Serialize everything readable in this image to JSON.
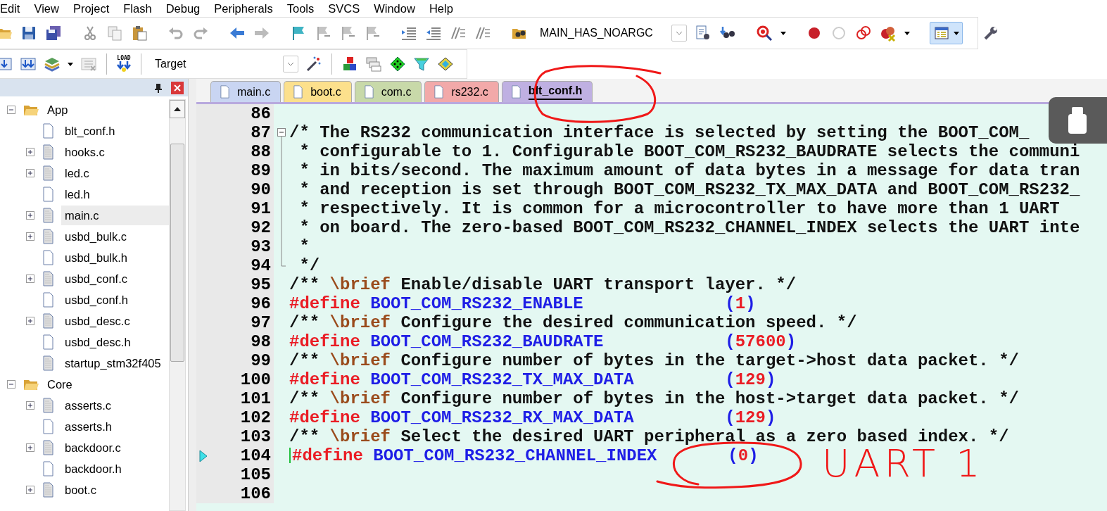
{
  "menu": [
    "Edit",
    "View",
    "Project",
    "Flash",
    "Debug",
    "Peripherals",
    "Tools",
    "SVCS",
    "Window",
    "Help"
  ],
  "toolbar": {
    "define_combo": "MAIN_HAS_NOARGC"
  },
  "build_toolbar": {
    "load_label": "LOAD",
    "target_combo": "Target"
  },
  "project_tree": [
    {
      "label": "App",
      "kind": "folder",
      "expanded": true,
      "selected": false,
      "children": [
        {
          "label": "blt_conf.h",
          "kind": "header",
          "expandable": false,
          "selected": false
        },
        {
          "label": "hooks.c",
          "kind": "source",
          "expandable": true,
          "selected": false
        },
        {
          "label": "led.c",
          "kind": "source",
          "expandable": true,
          "selected": false
        },
        {
          "label": "led.h",
          "kind": "header",
          "expandable": false,
          "selected": false
        },
        {
          "label": "main.c",
          "kind": "source",
          "expandable": true,
          "selected": true
        },
        {
          "label": "usbd_bulk.c",
          "kind": "source",
          "expandable": true,
          "selected": false
        },
        {
          "label": "usbd_bulk.h",
          "kind": "header",
          "expandable": false,
          "selected": false
        },
        {
          "label": "usbd_conf.c",
          "kind": "source",
          "expandable": true,
          "selected": false
        },
        {
          "label": "usbd_conf.h",
          "kind": "header",
          "expandable": false,
          "selected": false
        },
        {
          "label": "usbd_desc.c",
          "kind": "source",
          "expandable": true,
          "selected": false
        },
        {
          "label": "usbd_desc.h",
          "kind": "header",
          "expandable": false,
          "selected": false
        },
        {
          "label": "startup_stm32f405",
          "kind": "source",
          "expandable": false,
          "selected": false
        }
      ]
    },
    {
      "label": "Core",
      "kind": "folder",
      "expanded": true,
      "selected": false,
      "children": [
        {
          "label": "asserts.c",
          "kind": "source",
          "expandable": true,
          "selected": false
        },
        {
          "label": "asserts.h",
          "kind": "header",
          "expandable": false,
          "selected": false
        },
        {
          "label": "backdoor.c",
          "kind": "source",
          "expandable": true,
          "selected": false
        },
        {
          "label": "backdoor.h",
          "kind": "header",
          "expandable": false,
          "selected": false
        },
        {
          "label": "boot.c",
          "kind": "source",
          "expandable": true,
          "selected": false
        }
      ]
    }
  ],
  "tabs": [
    {
      "label": "main.c",
      "color": "#c9d5f2",
      "selected": false
    },
    {
      "label": "boot.c",
      "color": "#fce08c",
      "selected": false
    },
    {
      "label": "com.c",
      "color": "#c8d9a9",
      "selected": false
    },
    {
      "label": "rs232.c",
      "color": "#f2a9a9",
      "selected": false
    },
    {
      "label": "blt_conf.h",
      "color": "#bfb0e2",
      "selected": true
    }
  ],
  "code_lines": [
    {
      "number": "86",
      "kind": "plain"
    },
    {
      "number": "87",
      "kind": "fold_start",
      "segments": [
        {
          "kind": "comment",
          "text": "/* The RS232 communication interface is selected by setting the BOOT_COM_"
        }
      ]
    },
    {
      "number": "88",
      "kind": "fold_inside",
      "segments": [
        {
          "kind": "comment",
          "text": " * configurable to 1. Configurable BOOT_COM_RS232_BAUDRATE selects the communi"
        }
      ]
    },
    {
      "number": "89",
      "kind": "fold_inside",
      "segments": [
        {
          "kind": "comment",
          "text": " * in bits/second. The maximum amount of data bytes in a message for data tran"
        }
      ]
    },
    {
      "number": "90",
      "kind": "fold_inside",
      "segments": [
        {
          "kind": "comment",
          "text": " * and reception is set through BOOT_COM_RS232_TX_MAX_DATA and BOOT_COM_RS232_"
        }
      ]
    },
    {
      "number": "91",
      "kind": "fold_inside",
      "segments": [
        {
          "kind": "comment",
          "text": " * respectively. It is common for a microcontroller to have more than 1 UART"
        }
      ]
    },
    {
      "number": "92",
      "kind": "fold_inside",
      "segments": [
        {
          "kind": "comment",
          "text": " * on board. The zero-based BOOT_COM_RS232_CHANNEL_INDEX selects the UART inte"
        }
      ]
    },
    {
      "number": "93",
      "kind": "fold_inside",
      "segments": [
        {
          "kind": "comment",
          "text": " *"
        }
      ]
    },
    {
      "number": "94",
      "kind": "fold_end",
      "segments": [
        {
          "kind": "comment",
          "text": " */"
        }
      ]
    },
    {
      "number": "95",
      "kind": "plain",
      "segments": [
        {
          "kind": "comment",
          "text": "/** "
        },
        {
          "kind": "doctag",
          "text": "\\brief"
        },
        {
          "kind": "comment",
          "text": " Enable/disable UART transport layer. */"
        }
      ]
    },
    {
      "number": "96",
      "kind": "plain",
      "segments": [
        {
          "kind": "keyword",
          "text": "#define"
        },
        {
          "kind": "macro",
          "text": " BOOT_COM_RS232_ENABLE"
        },
        {
          "kind": "punct",
          "text": "("
        },
        {
          "kind": "number",
          "text": "1"
        },
        {
          "kind": "punct",
          "text": ")"
        }
      ]
    },
    {
      "number": "97",
      "kind": "plain",
      "segments": [
        {
          "kind": "comment",
          "text": "/** "
        },
        {
          "kind": "doctag",
          "text": "\\brief"
        },
        {
          "kind": "comment",
          "text": " Configure the desired communication speed. */"
        }
      ]
    },
    {
      "number": "98",
      "kind": "plain",
      "segments": [
        {
          "kind": "keyword",
          "text": "#define"
        },
        {
          "kind": "macro",
          "text": " BOOT_COM_RS232_BAUDRATE"
        },
        {
          "kind": "punct",
          "text": "("
        },
        {
          "kind": "number",
          "text": "57600"
        },
        {
          "kind": "punct",
          "text": ")"
        }
      ]
    },
    {
      "number": "99",
      "kind": "plain",
      "segments": [
        {
          "kind": "comment",
          "text": "/** "
        },
        {
          "kind": "doctag",
          "text": "\\brief"
        },
        {
          "kind": "comment",
          "text": " Configure number of bytes in the target->host data packet. */"
        }
      ]
    },
    {
      "number": "100",
      "kind": "plain",
      "segments": [
        {
          "kind": "keyword",
          "text": "#define"
        },
        {
          "kind": "macro",
          "text": " BOOT_COM_RS232_TX_MAX_DATA"
        },
        {
          "kind": "punct",
          "text": "("
        },
        {
          "kind": "number",
          "text": "129"
        },
        {
          "kind": "punct",
          "text": ")"
        }
      ]
    },
    {
      "number": "101",
      "kind": "plain",
      "segments": [
        {
          "kind": "comment",
          "text": "/** "
        },
        {
          "kind": "doctag",
          "text": "\\brief"
        },
        {
          "kind": "comment",
          "text": " Configure number of bytes in the host->target data packet. */"
        }
      ]
    },
    {
      "number": "102",
      "kind": "plain",
      "segments": [
        {
          "kind": "keyword",
          "text": "#define"
        },
        {
          "kind": "macro",
          "text": " BOOT_COM_RS232_RX_MAX_DATA"
        },
        {
          "kind": "punct",
          "text": "("
        },
        {
          "kind": "number",
          "text": "129"
        },
        {
          "kind": "punct",
          "text": ")"
        }
      ]
    },
    {
      "number": "103",
      "kind": "plain",
      "segments": [
        {
          "kind": "comment",
          "text": "/** "
        },
        {
          "kind": "doctag",
          "text": "\\brief"
        },
        {
          "kind": "comment",
          "text": " Select the desired UART peripheral as a zero based index. */"
        }
      ]
    },
    {
      "number": "104",
      "kind": "plain",
      "current": true,
      "segments": [
        {
          "kind": "keyword",
          "text": "#define"
        },
        {
          "kind": "macro",
          "text": " BOOT_COM_RS232_CHANNEL_INDEX"
        },
        {
          "kind": "punct",
          "text": "("
        },
        {
          "kind": "number",
          "text": "0"
        },
        {
          "kind": "punct",
          "text": ")"
        }
      ]
    },
    {
      "number": "105",
      "kind": "plain"
    },
    {
      "number": "106",
      "kind": "plain"
    }
  ],
  "annotations": [
    {
      "kind": "circle"
    },
    {
      "kind": "circle"
    },
    {
      "kind": "text",
      "text": "UART 1"
    }
  ]
}
